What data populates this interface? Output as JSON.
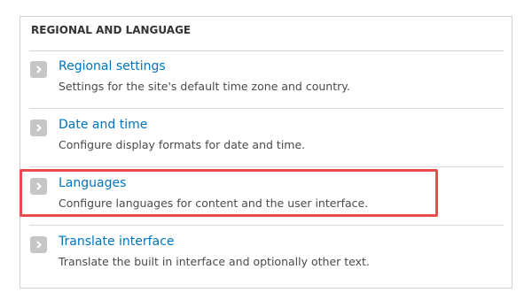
{
  "section": {
    "title": "REGIONAL AND LANGUAGE"
  },
  "items": [
    {
      "label": "Regional settings",
      "description": "Settings for the site's default time zone and country."
    },
    {
      "label": "Date and time",
      "description": "Configure display formats for date and time."
    },
    {
      "label": "Languages",
      "description": "Configure languages for content and the user interface."
    },
    {
      "label": "Translate interface",
      "description": "Translate the built in interface and optionally other text."
    }
  ],
  "colors": {
    "link": "#0074bd",
    "arrow_bg": "#c6c6c6",
    "highlight": "#e84c4c"
  },
  "icons": {
    "arrow": "chevron-right-icon"
  }
}
